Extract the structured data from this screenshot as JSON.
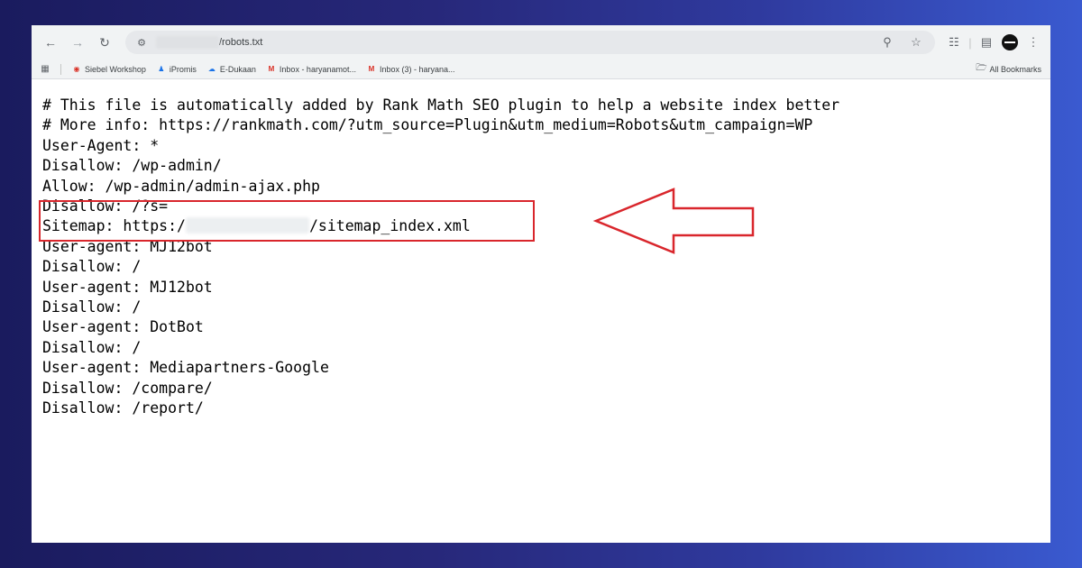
{
  "browser": {
    "url_suffix": "/robots.txt",
    "bookmarks": [
      {
        "label": "Siebel Workshop",
        "icon": "globe-icon",
        "color": "#d93025"
      },
      {
        "label": "iPromis",
        "icon": "people-icon",
        "color": "#1a73e8"
      },
      {
        "label": "E-Dukaan",
        "icon": "cloud-icon",
        "color": "#1a73e8"
      },
      {
        "label": "Inbox - haryanamot...",
        "icon": "gmail-icon",
        "color": "#d93025"
      },
      {
        "label": "Inbox (3) - haryana...",
        "icon": "gmail-icon",
        "color": "#d93025"
      }
    ],
    "all_bookmarks": "All Bookmarks"
  },
  "robots_lines": [
    "# This file is automatically added by Rank Math SEO plugin to help a website index better",
    "# More info: https://rankmath.com/?utm_source=Plugin&utm_medium=Robots&utm_campaign=WP",
    "User-Agent: *",
    "Disallow: /wp-admin/",
    "Allow: /wp-admin/admin-ajax.php",
    "Disallow: /?s=",
    "Sitemap: https:/",
    "User-agent: MJ12bot",
    "Disallow: /",
    "User-agent: MJ12bot",
    "Disallow: /",
    "User-agent: DotBot",
    "Disallow: /",
    "User-agent: Mediapartners-Google",
    "Disallow: /compare/",
    "Disallow: /report/"
  ],
  "sitemap_suffix": "/sitemap_index.xml",
  "annotation_color": "#d9262c"
}
